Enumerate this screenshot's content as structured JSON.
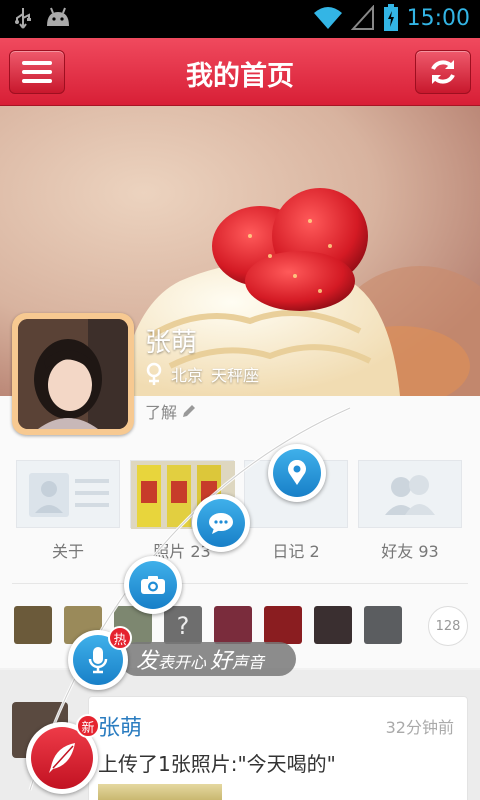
{
  "status_bar": {
    "time": "15:00",
    "icons": [
      "usb-icon",
      "android-icon",
      "wifi-icon",
      "signal-icon",
      "battery-icon"
    ]
  },
  "header": {
    "title": "我的首页",
    "menu_icon": "menu-icon",
    "refresh_icon": "refresh-icon"
  },
  "profile": {
    "name": "张萌",
    "gender_icon": "female-icon",
    "location": "北京",
    "zodiac": "天秤座",
    "about_label": "了解"
  },
  "tiles": [
    {
      "label": "关于"
    },
    {
      "label": "照片 23"
    },
    {
      "label": "日记 2"
    },
    {
      "label": "好友 93"
    }
  ],
  "friends_strip": {
    "more_count": "128"
  },
  "arc_menu": {
    "location_icon": "location-pin-icon",
    "chat_icon": "chat-bubble-icon",
    "camera_icon": "camera-icon",
    "mic_icon": "microphone-icon",
    "hot_badge": "热",
    "voice_prompt_part1": "发",
    "voice_prompt_part2": "表开心",
    "voice_prompt_part3": "好",
    "voice_prompt_part4": "声音"
  },
  "feed": {
    "new_badge": "新",
    "post": {
      "author": "张萌",
      "time": "32分钟前",
      "text": "上传了1张照片:\"今天喝的\""
    }
  },
  "colors": {
    "brand_red": "#d81f36",
    "accent_blue": "#1880c8",
    "name_blue": "#2a7cc0"
  }
}
